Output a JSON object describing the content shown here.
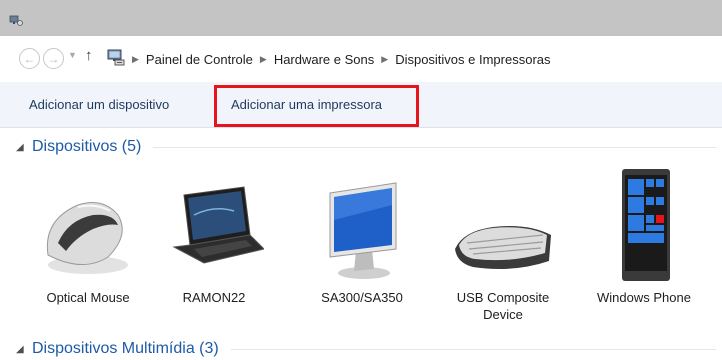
{
  "window": {
    "app_icon": "devices-printers-icon"
  },
  "address_bar": {
    "back_icon": "back-arrow-icon",
    "forward_icon": "forward-arrow-icon",
    "recent_icon": "chevron-down-icon",
    "up_icon": "up-arrow-icon",
    "location_icon": "control-panel-icon",
    "breadcrumbs": [
      "Painel de Controle",
      "Hardware e Sons",
      "Dispositivos e Impressoras"
    ]
  },
  "toolbar": {
    "add_device": "Adicionar um dispositivo",
    "add_printer": "Adicionar uma impressora",
    "highlight_color": "#e8141b"
  },
  "groups": [
    {
      "title": "Dispositivos (5)",
      "devices": [
        {
          "label": "Optical Mouse",
          "icon": "mouse-icon"
        },
        {
          "label": "RAMON22",
          "icon": "laptop-icon"
        },
        {
          "label": "SA300/SA350",
          "icon": "monitor-icon"
        },
        {
          "label": "USB Composite Device",
          "icon": "keyboard-icon"
        },
        {
          "label": "Windows Phone",
          "icon": "phone-icon"
        }
      ]
    },
    {
      "title": "Dispositivos Multimídia (3)"
    }
  ],
  "colors": {
    "group_title": "#1e5aa8",
    "toolbar_bg": "#f1f5fb",
    "titlebar_bg": "#c4c4c4"
  }
}
